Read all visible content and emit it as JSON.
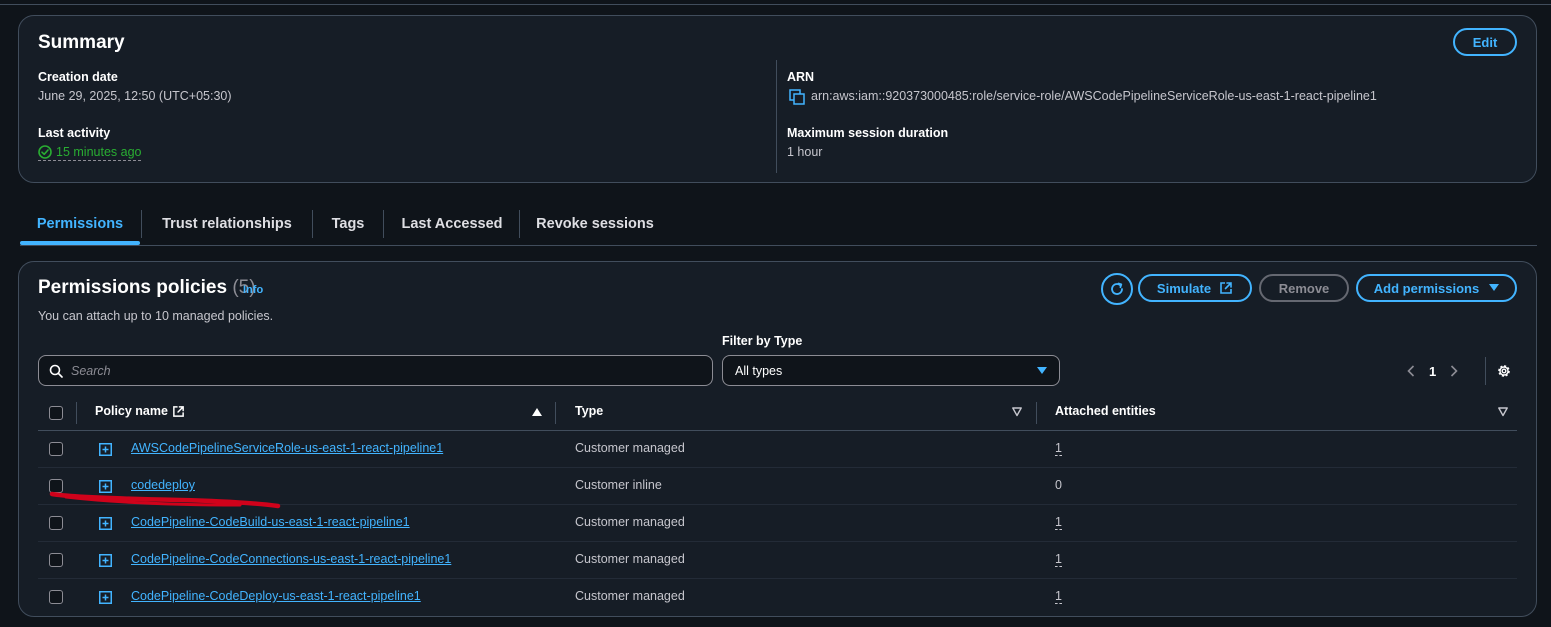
{
  "summary": {
    "title": "Summary",
    "edit_label": "Edit",
    "creation_date_label": "Creation date",
    "creation_date_value": "June 29, 2025, 12:50 (UTC+05:30)",
    "last_activity_label": "Last activity",
    "last_activity_value": "15 minutes ago",
    "arn_label": "ARN",
    "arn_value": "arn:aws:iam::920373000485:role/service-role/AWSCodePipelineServiceRole-us-east-1-react-pipeline1",
    "max_session_label": "Maximum session duration",
    "max_session_value": "1 hour"
  },
  "tabs": [
    {
      "label": "Permissions",
      "active": true
    },
    {
      "label": "Trust relationships"
    },
    {
      "label": "Tags"
    },
    {
      "label": "Last Accessed"
    },
    {
      "label": "Revoke sessions"
    }
  ],
  "permissions": {
    "title": "Permissions policies",
    "count": "(5)",
    "info_label": "Info",
    "description": "You can attach up to 10 managed policies.",
    "simulate_label": "Simulate",
    "remove_label": "Remove",
    "add_label": "Add permissions",
    "search_placeholder": "Search",
    "filter_label": "Filter by Type",
    "filter_value": "All types",
    "page_number": "1",
    "columns": {
      "policy_name": "Policy name",
      "type": "Type",
      "attached": "Attached entities"
    },
    "rows": [
      {
        "name": "AWSCodePipelineServiceRole-us-east-1-react-pipeline1",
        "type": "Customer managed",
        "attached": "1"
      },
      {
        "name": "codedeploy",
        "type": "Customer inline",
        "attached": "0"
      },
      {
        "name": "CodePipeline-CodeBuild-us-east-1-react-pipeline1",
        "type": "Customer managed",
        "attached": "1"
      },
      {
        "name": "CodePipeline-CodeConnections-us-east-1-react-pipeline1",
        "type": "Customer managed",
        "attached": "1"
      },
      {
        "name": "CodePipeline-CodeDeploy-us-east-1-react-pipeline1",
        "type": "Customer managed",
        "attached": "1"
      }
    ]
  },
  "colors": {
    "accent": "#42b4ff",
    "success": "#29ad32",
    "annotation": "#d0021b"
  }
}
